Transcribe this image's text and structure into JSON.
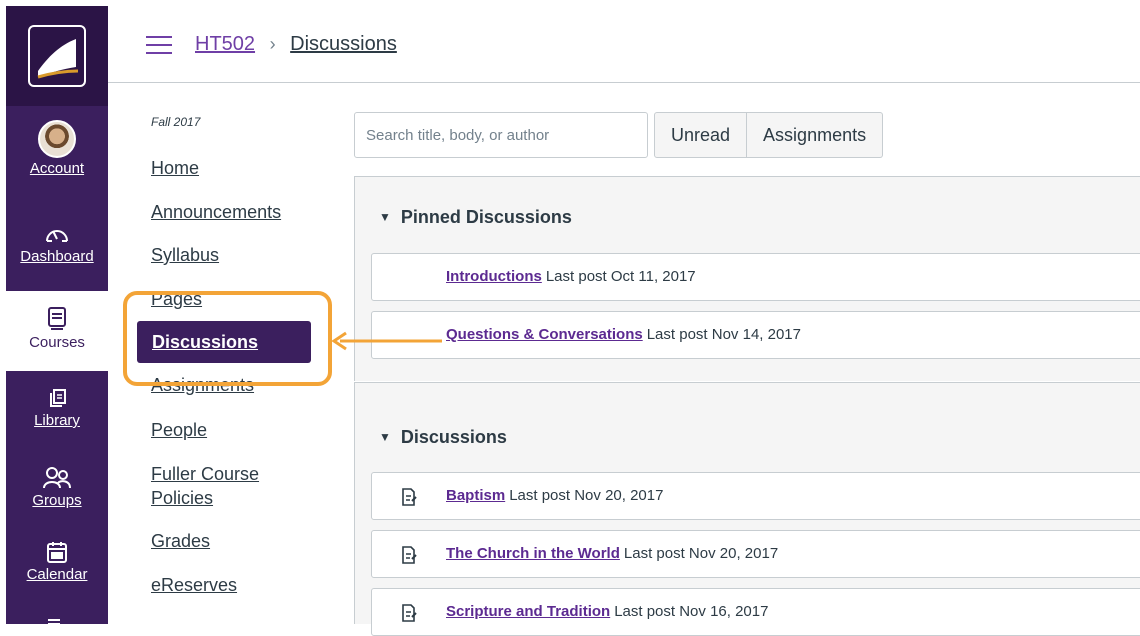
{
  "global_nav": {
    "items": [
      {
        "label": "Account",
        "icon": "avatar"
      },
      {
        "label": "Dashboard",
        "icon": "dashboard-icon"
      },
      {
        "label": "Courses",
        "icon": "courses-icon",
        "active": true
      },
      {
        "label": "Library",
        "icon": "library-icon"
      },
      {
        "label": "Groups",
        "icon": "groups-icon"
      },
      {
        "label": "Calendar",
        "icon": "calendar-icon"
      }
    ]
  },
  "breadcrumb": {
    "course": "HT502",
    "page": "Discussions"
  },
  "course_nav": {
    "term": "Fall 2017",
    "items": [
      {
        "label": "Home"
      },
      {
        "label": "Announcements"
      },
      {
        "label": "Syllabus"
      },
      {
        "label": "Pages"
      },
      {
        "label": "Discussions",
        "active": true
      },
      {
        "label": "Assignments"
      },
      {
        "label": "People"
      },
      {
        "label": "Fuller Course Policies"
      },
      {
        "label": "Grades"
      },
      {
        "label": "eReserves"
      }
    ]
  },
  "toolbar": {
    "search_placeholder": "Search title, body, or author",
    "filter_unread": "Unread",
    "filter_assignments": "Assignments"
  },
  "pinned": {
    "title": "Pinned Discussions",
    "items": [
      {
        "title": "Introductions",
        "meta": "Last post Oct 11, 2017"
      },
      {
        "title": "Questions & Conversations",
        "meta": "Last post Nov 14, 2017"
      }
    ]
  },
  "discussions": {
    "title": "Discussions",
    "items": [
      {
        "title": "Baptism",
        "meta": "Last post Nov 20, 2017"
      },
      {
        "title": "The Church in the World",
        "meta": "Last post Nov 20, 2017"
      },
      {
        "title": "Scripture and Tradition",
        "meta": "Last post Nov 16, 2017"
      }
    ]
  },
  "colors": {
    "nav_bg": "#3b1f5e",
    "accent_link": "#5c2a91",
    "highlight": "#f3a437"
  }
}
